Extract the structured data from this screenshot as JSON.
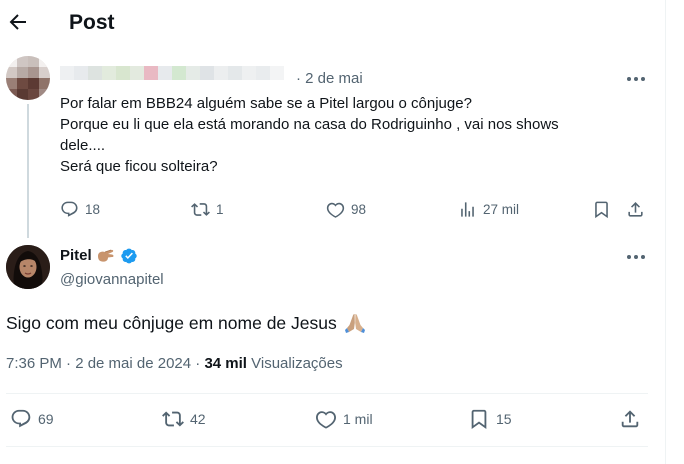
{
  "header": {
    "title": "Post",
    "back_icon": "arrow-left-icon"
  },
  "parent_post": {
    "date": "· 2 de mai",
    "text_lines": [
      "Por falar em BBB24 alguém sabe se a Pitel largou o cônjuge?",
      "Porque eu li que ela está morando na casa do Rodriguinho , vai nos shows",
      "dele....",
      "Será que ficou solteira?"
    ],
    "actions": {
      "replies": "18",
      "reposts": "1",
      "likes": "98",
      "views": "27 mil"
    }
  },
  "main_post": {
    "display_name": "Pitel",
    "handle": "@giovannapitel",
    "text": "Sigo com meu cônjuge em nome de Jesus",
    "time": "7:36 PM · 2 de mai de 2024 · ",
    "views_count": "34 mil",
    "views_label": " Visualizações",
    "actions": {
      "replies": "69",
      "reposts": "42",
      "likes": "1 mil",
      "bookmarks": "15"
    }
  },
  "colors": {
    "text": "#0f1419",
    "secondary": "#536471",
    "verified": "#1d9bf0",
    "divider": "#eff3f4"
  }
}
